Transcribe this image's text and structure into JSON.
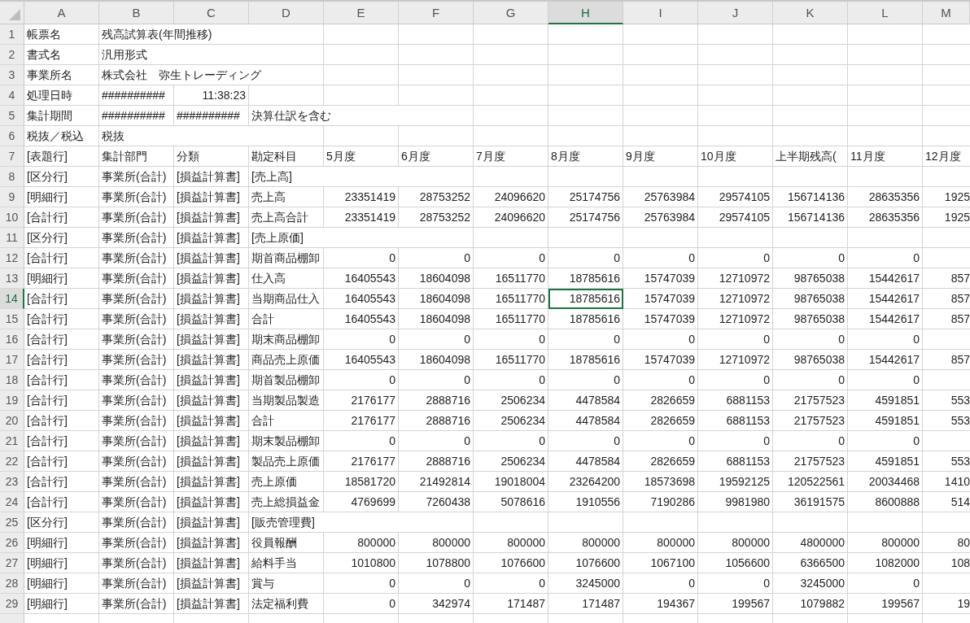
{
  "columns": [
    {
      "label": "A",
      "selected": false
    },
    {
      "label": "B",
      "selected": false
    },
    {
      "label": "C",
      "selected": false
    },
    {
      "label": "D",
      "selected": false
    },
    {
      "label": "E",
      "selected": false
    },
    {
      "label": "F",
      "selected": false
    },
    {
      "label": "G",
      "selected": false
    },
    {
      "label": "H",
      "selected": true
    },
    {
      "label": "I",
      "selected": false
    },
    {
      "label": "J",
      "selected": false
    },
    {
      "label": "K",
      "selected": false
    },
    {
      "label": "L",
      "selected": false
    },
    {
      "label": "M",
      "selected": false
    }
  ],
  "rows": [
    {
      "label": "1",
      "selected": false,
      "kind": "info",
      "cells": [
        "帳票名",
        "残高試算表(年間推移)"
      ]
    },
    {
      "label": "2",
      "selected": false,
      "kind": "info",
      "cells": [
        "書式名",
        "汎用形式"
      ]
    },
    {
      "label": "3",
      "selected": false,
      "kind": "info",
      "cells": [
        "事業所名",
        "株式会社　弥生トレーディング"
      ]
    },
    {
      "label": "4",
      "selected": false,
      "kind": "info",
      "cells": [
        "処理日時",
        "##########",
        {
          "text": "11:38:23",
          "kind": "time"
        }
      ]
    },
    {
      "label": "5",
      "selected": false,
      "kind": "info",
      "cells": [
        "集計期間",
        "##########",
        "##########",
        "決算仕訳を含む"
      ]
    },
    {
      "label": "6",
      "selected": false,
      "kind": "info",
      "cells": [
        "税抜／税込",
        "税抜"
      ]
    },
    {
      "label": "7",
      "selected": false,
      "kind": "info",
      "cells": [
        "[表題行]",
        "集計部門",
        "分類",
        "勘定科目",
        "5月度",
        "6月度",
        "7月度",
        "8月度",
        "9月度",
        "10月度",
        "上半期残高(",
        "11月度",
        "12月度"
      ]
    },
    {
      "label": "8",
      "selected": false,
      "kind": "data",
      "cells": [
        "[区分行]",
        "事業所(合計)",
        "[損益計算書]",
        "[売上高]"
      ]
    },
    {
      "label": "9",
      "selected": false,
      "kind": "data",
      "cells": [
        "[明細行]",
        "事業所(合計)",
        "[損益計算書]",
        "売上高",
        "23351419",
        "28753252",
        "24096620",
        "25174756",
        "25763984",
        "29574105",
        "156714136",
        "28635356",
        "1925"
      ]
    },
    {
      "label": "10",
      "selected": false,
      "kind": "data",
      "cells": [
        "[合計行]",
        "事業所(合計)",
        "[損益計算書]",
        "売上高合計",
        "23351419",
        "28753252",
        "24096620",
        "25174756",
        "25763984",
        "29574105",
        "156714136",
        "28635356",
        "1925"
      ]
    },
    {
      "label": "11",
      "selected": false,
      "kind": "data",
      "cells": [
        "[区分行]",
        "事業所(合計)",
        "[損益計算書]",
        "[売上原価]"
      ]
    },
    {
      "label": "12",
      "selected": false,
      "kind": "data",
      "cells": [
        "[合計行]",
        "事業所(合計)",
        "[損益計算書]",
        "期首商品棚卸",
        "0",
        "0",
        "0",
        "0",
        "0",
        "0",
        "0",
        "0"
      ]
    },
    {
      "label": "13",
      "selected": false,
      "kind": "data",
      "cells": [
        "[明細行]",
        "事業所(合計)",
        "[損益計算書]",
        "仕入高",
        "16405543",
        "18604098",
        "16511770",
        "18785616",
        "15747039",
        "12710972",
        "98765038",
        "15442617",
        "857"
      ]
    },
    {
      "label": "14",
      "selected": true,
      "kind": "data",
      "cells": [
        "[合計行]",
        "事業所(合計)",
        "[損益計算書]",
        "当期商品仕入",
        "16405543",
        "18604098",
        "16511770",
        "18785616",
        "15747039",
        "12710972",
        "98765038",
        "15442617",
        "857"
      ]
    },
    {
      "label": "15",
      "selected": false,
      "kind": "data",
      "cells": [
        "[合計行]",
        "事業所(合計)",
        "[損益計算書]",
        "合計",
        "16405543",
        "18604098",
        "16511770",
        "18785616",
        "15747039",
        "12710972",
        "98765038",
        "15442617",
        "857"
      ]
    },
    {
      "label": "16",
      "selected": false,
      "kind": "data",
      "cells": [
        "[合計行]",
        "事業所(合計)",
        "[損益計算書]",
        "期末商品棚卸",
        "0",
        "0",
        "0",
        "0",
        "0",
        "0",
        "0",
        "0"
      ]
    },
    {
      "label": "17",
      "selected": false,
      "kind": "data",
      "cells": [
        "[合計行]",
        "事業所(合計)",
        "[損益計算書]",
        "商品売上原価",
        "16405543",
        "18604098",
        "16511770",
        "18785616",
        "15747039",
        "12710972",
        "98765038",
        "15442617",
        "857"
      ]
    },
    {
      "label": "18",
      "selected": false,
      "kind": "data",
      "cells": [
        "[合計行]",
        "事業所(合計)",
        "[損益計算書]",
        "期首製品棚卸",
        "0",
        "0",
        "0",
        "0",
        "0",
        "0",
        "0",
        "0"
      ]
    },
    {
      "label": "19",
      "selected": false,
      "kind": "data",
      "cells": [
        "[合計行]",
        "事業所(合計)",
        "[損益計算書]",
        "当期製品製造",
        "2176177",
        "2888716",
        "2506234",
        "4478584",
        "2826659",
        "6881153",
        "21757523",
        "4591851",
        "553"
      ]
    },
    {
      "label": "20",
      "selected": false,
      "kind": "data",
      "cells": [
        "[合計行]",
        "事業所(合計)",
        "[損益計算書]",
        "合計",
        "2176177",
        "2888716",
        "2506234",
        "4478584",
        "2826659",
        "6881153",
        "21757523",
        "4591851",
        "553"
      ]
    },
    {
      "label": "21",
      "selected": false,
      "kind": "data",
      "cells": [
        "[合計行]",
        "事業所(合計)",
        "[損益計算書]",
        "期末製品棚卸",
        "0",
        "0",
        "0",
        "0",
        "0",
        "0",
        "0",
        "0"
      ]
    },
    {
      "label": "22",
      "selected": false,
      "kind": "data",
      "cells": [
        "[合計行]",
        "事業所(合計)",
        "[損益計算書]",
        "製品売上原価",
        "2176177",
        "2888716",
        "2506234",
        "4478584",
        "2826659",
        "6881153",
        "21757523",
        "4591851",
        "553"
      ]
    },
    {
      "label": "23",
      "selected": false,
      "kind": "data",
      "cells": [
        "[合計行]",
        "事業所(合計)",
        "[損益計算書]",
        "売上原価",
        "18581720",
        "21492814",
        "19018004",
        "23264200",
        "18573698",
        "19592125",
        "120522561",
        "20034468",
        "1410"
      ]
    },
    {
      "label": "24",
      "selected": false,
      "kind": "data",
      "cells": [
        "[合計行]",
        "事業所(合計)",
        "[損益計算書]",
        "売上総損益金",
        "4769699",
        "7260438",
        "5078616",
        "1910556",
        "7190286",
        "9981980",
        "36191575",
        "8600888",
        "514"
      ]
    },
    {
      "label": "25",
      "selected": false,
      "kind": "data",
      "cells": [
        "[区分行]",
        "事業所(合計)",
        "[損益計算書]",
        "[販売管理費]"
      ]
    },
    {
      "label": "26",
      "selected": false,
      "kind": "data",
      "cells": [
        "[明細行]",
        "事業所(合計)",
        "[損益計算書]",
        "役員報酬",
        "800000",
        "800000",
        "800000",
        "800000",
        "800000",
        "800000",
        "4800000",
        "800000",
        "80"
      ]
    },
    {
      "label": "27",
      "selected": false,
      "kind": "data",
      "cells": [
        "[明細行]",
        "事業所(合計)",
        "[損益計算書]",
        "給料手当",
        "1010800",
        "1078800",
        "1076600",
        "1076600",
        "1067100",
        "1056600",
        "6366500",
        "1082000",
        "108"
      ]
    },
    {
      "label": "28",
      "selected": false,
      "kind": "data",
      "cells": [
        "[明細行]",
        "事業所(合計)",
        "[損益計算書]",
        "賞与",
        "0",
        "0",
        "0",
        "3245000",
        "0",
        "0",
        "3245000",
        "0"
      ]
    },
    {
      "label": "29",
      "selected": false,
      "kind": "data",
      "cells": [
        "[明細行]",
        "事業所(合計)",
        "[損益計算書]",
        "法定福利費",
        "0",
        "342974",
        "171487",
        "171487",
        "194367",
        "199567",
        "1079882",
        "199567",
        "19"
      ]
    }
  ]
}
